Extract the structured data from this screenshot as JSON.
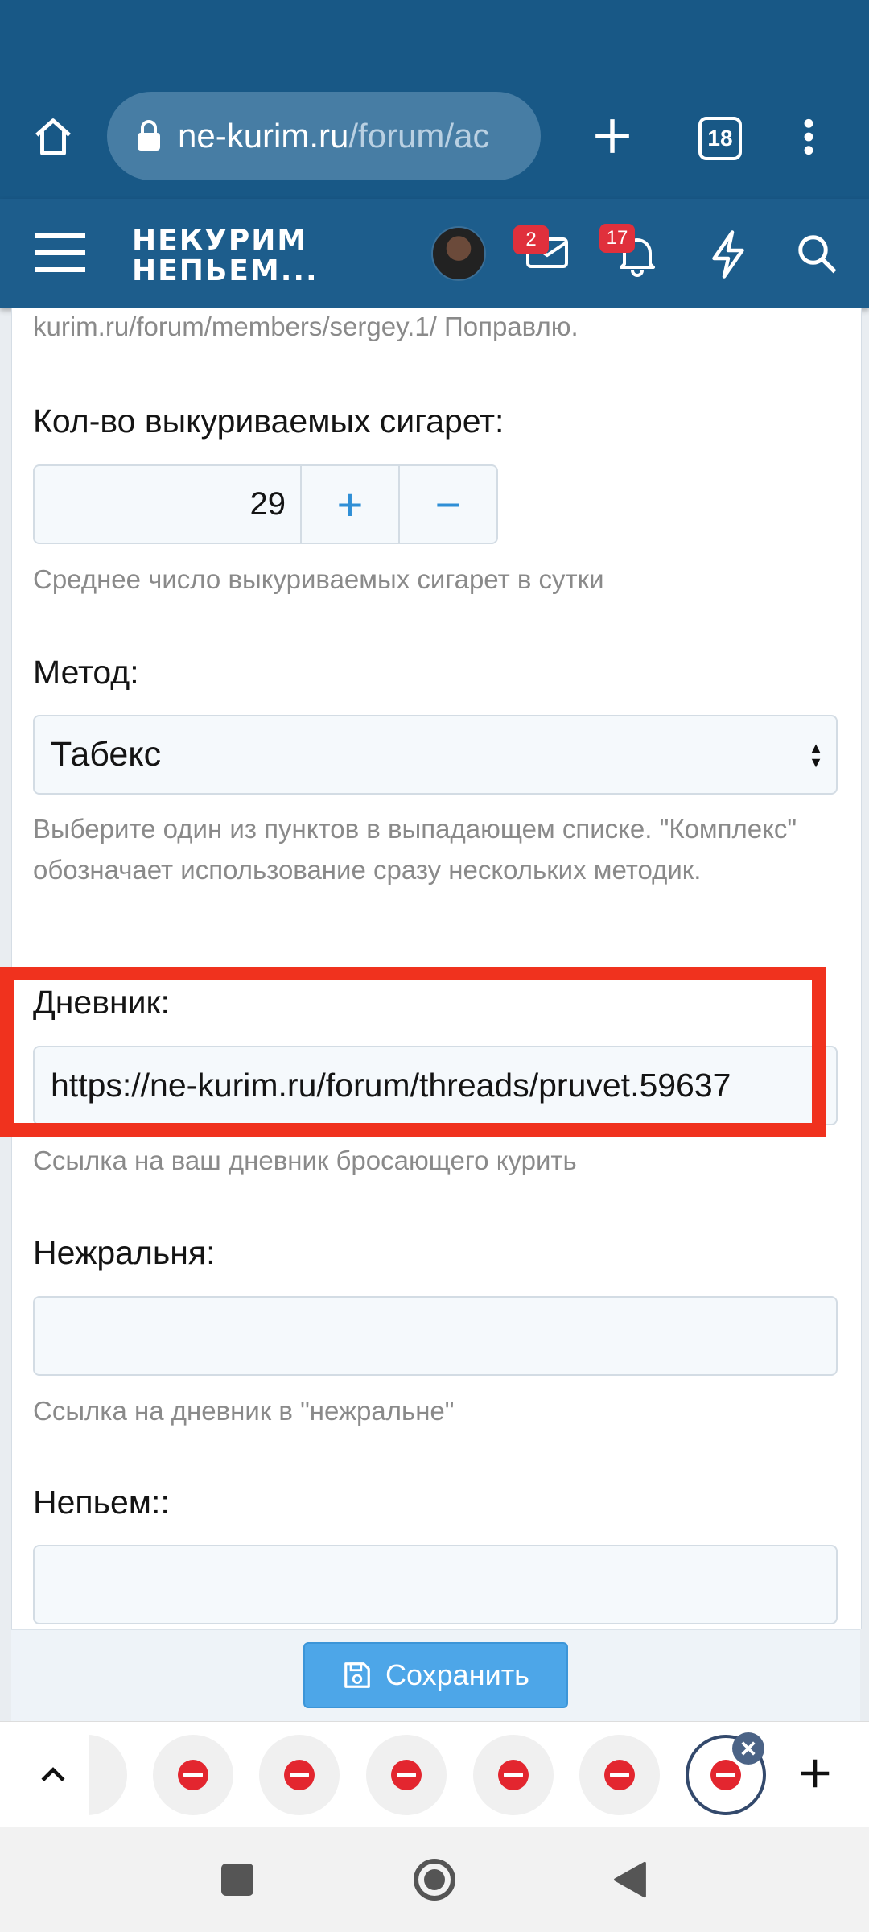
{
  "browser": {
    "url_host": "ne-kurim.ru",
    "url_path": "/forum/ac",
    "tab_count": "18"
  },
  "site": {
    "logo_line1": "НЕКУРИМ",
    "logo_line2": "НЕПЬЕМ...",
    "messages_badge": "2",
    "alerts_badge": "17"
  },
  "form": {
    "top_text": "kurim.ru/forum/members/sergey.1/ Поправлю.",
    "cigarettes_label": "Кол-во выкуриваемых сигарет:",
    "cigarettes_value": "29",
    "plus": "+",
    "minus": "−",
    "cigarettes_hint": "Среднее число выкуриваемых сигарет в сутки",
    "method_label": "Метод:",
    "method_value": "Табекс",
    "method_hint": "Выберите один из пунктов в выпадающем списке. \"Комплекс\" обозначает использование сразу нескольких методик.",
    "diary_label": "Дневник:",
    "diary_value": "https://ne-kurim.ru/forum/threads/pruvet.59637",
    "diary_hint": "Ссылка на ваш дневник бросающего курить",
    "glutton_label": "Нежральня:",
    "glutton_value": "",
    "glutton_hint": "Ссылка на дневник в \"нежральне\"",
    "drink_label": "Непьем::",
    "drink_value": "",
    "save_label": "Сохранить"
  },
  "colors": {
    "header": "#185886",
    "highlight": "#f0321e",
    "button": "#4da6e8"
  }
}
